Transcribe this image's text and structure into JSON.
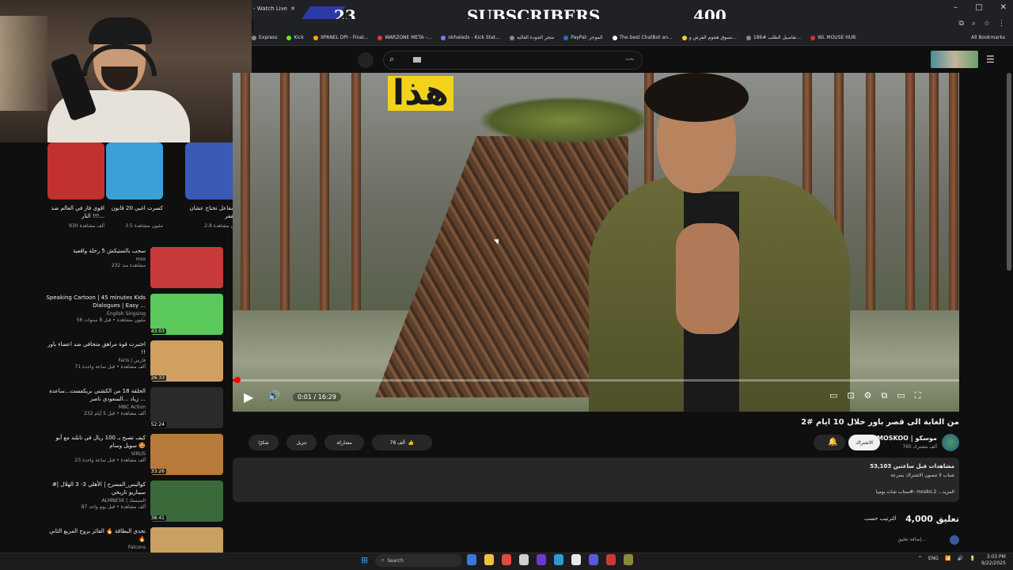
{
  "browser": {
    "tab_title": "- Watch Live",
    "new_tab": "+",
    "window_controls": [
      "–",
      "□",
      "✕"
    ],
    "address_icons": [
      "⧉",
      "⌕",
      "☆",
      "⋮"
    ],
    "bookmarks": [
      {
        "label": "Express",
        "color": "#888"
      },
      {
        "label": "Kick",
        "color": "#53fc18"
      },
      {
        "label": "XPANEL DPI - Final...",
        "color": "#ffaa00"
      },
      {
        "label": "WARZONE META -...",
        "color": "#e33"
      },
      {
        "label": "okhaledx - Kick Stat...",
        "color": "#7a7aff"
      },
      {
        "label": "متجر الجودة العالية",
        "color": "#888"
      },
      {
        "label": "PayPal: الموجز",
        "color": "#2a6ad6"
      },
      {
        "label": "The best ChatBot an...",
        "color": "#fff"
      },
      {
        "label": "تسوق هجوم الفرش و...",
        "color": "#ffd21a"
      },
      {
        "label": "تفاصيل الطلب #186...",
        "color": "#888"
      },
      {
        "label": "WL MOUSE HUB",
        "color": "#c33"
      }
    ],
    "all_bookmarks": "All Bookmarks"
  },
  "subscriber_banner": {
    "left_count": "23",
    "label": "SUBSCRIBERS",
    "right_count": "400"
  },
  "yt_header": {
    "search_placeholder": "بحث",
    "search_icon": "⌕",
    "menu_icon": "☰"
  },
  "shorts": [
    {
      "title": "كم مفاعل تحتاج عشان تقفر ...",
      "views": "2.8 مليون مشاهدة",
      "color": "#3a5ab8"
    },
    {
      "title": "كسرت اغبى 20 قانون",
      "views": "3.5 مليون مشاهدة",
      "color": "#3aa0d8"
    },
    {
      "title": "اقوى فاز في العالم ضد النار !!!...",
      "views": "930 ألف مشاهدة",
      "color": "#c23030"
    }
  ],
  "recommendations": [
    {
      "title": "سحب بالستيكش 5 رحلة واقعية",
      "channel": "msx",
      "meta": "232 مشاهدة منذ",
      "duration": "",
      "color": "#c83a3a"
    },
    {
      "title": "Speaking Cartoon | 45 minutes Kids Dialogues | Easy ...",
      "channel": "English Singsing",
      "meta": "56 مليون مشاهدة • قبل 8 سنوات",
      "duration": "43:03",
      "color": "#5ac85a"
    },
    {
      "title": "اختبرت قوة مراهق متحافي ضد اعضاء باور !!",
      "channel": "Faris | فارس",
      "meta": "71 ألف مشاهدة • قبل ساعة واحدة",
      "duration": "26:33",
      "color": "#d0a060"
    },
    {
      "title": "الحلقة 18 من الكشتي بريكفست...ساعدة زياد ...السعودي ناصر ...",
      "channel": "MBC Action",
      "meta": "232 ألف مشاهدة • قبل 5 أيام",
      "duration": "52:24",
      "color": "#2a2a2a"
    },
    {
      "title": "كيف تصبح بـ 100 ريال في تايلند مع أبو سويل وسام 🤩",
      "channel": "VIRUS",
      "meta": "23 ألف مشاهدة • قبل ساعة واحدة",
      "duration": "33:26",
      "color": "#b87a3a"
    },
    {
      "title": "#كواليس_المسرح | الأهلي 3- 3 الهلال | سيناريو تاريخي",
      "channel": "ALMNESK | المنيسك",
      "meta": "87 ألف مشاهدة • قبل يوم واحد",
      "duration": "38:41",
      "color": "#3a6a3a"
    },
    {
      "title": "تحدي البطاقة 🔥 الفائز يروح المريع الثاني 🔥",
      "channel": "Falcons",
      "meta": "",
      "duration": "",
      "color": "#c8a060"
    }
  ],
  "player": {
    "overlay_text": "هذا",
    "time": "0:01 / 16:29",
    "progress": 0.001,
    "play_icon": "▶",
    "volume_icon": "🔊",
    "right_controls": [
      "▭",
      "⊡",
      "⚙",
      "⧉",
      "▭",
      "⛶"
    ]
  },
  "video": {
    "title": "من الغابة الى قصر باور خلال 10 ايام #2",
    "channel_name": "MOSKOO | موسكو",
    "subscribers": "765 ألف مشترك",
    "subscribe_label": "الاشتراك",
    "bell_icon": "🔔",
    "likes": "76 ألف",
    "share": "مشاركة",
    "download": "تنزيل",
    "thanks": "شكرًا"
  },
  "description": {
    "views": "53,103 مشاهدات  قبل ساعتين",
    "line1": "شباب لا تنسون الاشتراك بسرعة",
    "line2": "ستاب شات يوميا#: mosko.2 ...المزيد"
  },
  "comments": {
    "count": "4,000 تعليق",
    "sort": "الترتيب حسب",
    "add": "إضافة تعليق..."
  },
  "taskbar": {
    "start_icon": "⊞",
    "search_label": "Search",
    "tray_lang": "ENG",
    "tray_icons": [
      "^",
      "📶",
      "🔊",
      "🔋"
    ],
    "time": "3:03 PM",
    "date": "9/22/2025",
    "apps": [
      "#3a78d6",
      "#f0c040",
      "#e04a3a",
      "#d0d0d0",
      "#6a3ad0",
      "#2a9ad8",
      "#e8e8e8",
      "#5a5ad8",
      "#c83a3a",
      "#8a8a3a"
    ]
  }
}
